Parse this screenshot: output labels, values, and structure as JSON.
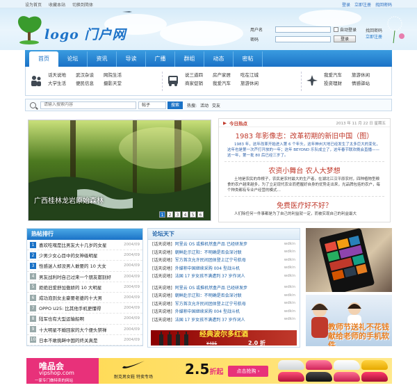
{
  "topbar": {
    "left_links": [
      "设为首页",
      "收藏本站",
      "切换到简体"
    ],
    "right_links": [
      "登录",
      "立即注册",
      "找回密码"
    ]
  },
  "header": {
    "logo_text": "logo 门户网"
  },
  "login": {
    "username_label": "用户名",
    "password_label": "密码",
    "remember_label": "自动登录",
    "login_button": "登录",
    "user_menu": [
      "找回密码",
      "立即注册"
    ]
  },
  "nav": {
    "items": [
      {
        "label": "首页",
        "active": true
      },
      {
        "label": "论坛",
        "active": false
      },
      {
        "label": "资讯",
        "active": false
      },
      {
        "label": "导读",
        "active": false
      },
      {
        "label": "广播",
        "active": false
      },
      {
        "label": "群组",
        "active": false
      },
      {
        "label": "动态",
        "active": false
      },
      {
        "label": "密帖",
        "active": false
      }
    ]
  },
  "subnav": {
    "groups": [
      {
        "icon": "people-icon",
        "links": [
          "话天说地",
          "武汉杂谈",
          "网院生活",
          "大学生活",
          "便民信息",
          "摄影天堂"
        ]
      },
      {
        "icon": "bus-icon",
        "links": [
          "说三道四",
          "房产家居",
          "吃在江城",
          "商家促销",
          "我爱汽车",
          "旅游休闲"
        ]
      },
      {
        "icon": "plane-icon",
        "links": [
          "我爱汽车",
          "旅游休闲",
          "投资理财",
          "情感驿站"
        ]
      }
    ]
  },
  "search": {
    "placeholder": "请输入搜索内容",
    "category": "帖子",
    "button": "搜索",
    "hot_label": "热搜:",
    "hot_words": [
      "活动",
      "交友"
    ]
  },
  "slideshow": {
    "caption": "广西桂林龙岩原始森林",
    "pages": [
      "1",
      "2",
      "3",
      "4",
      "5",
      "6"
    ],
    "active_page": "1"
  },
  "today_hot": {
    "title": "今日热点",
    "date": "2013 年 11 月 22 日 星期五",
    "headline1": "1983 年影像志：改革初期的新旧中国（图）",
    "desc1": "1983 年，这年改革开始进入第 6 个年头，这年神州大地已经发生了太多巨大的变化，这年也是第一次芦打开放的一年；这年 BEYOND 乐队成立了，这年春节联欢晚会直播——这一年，第一批 80 后已经三岁了。",
    "headline2": "农资小舞台 农人大梦想",
    "desc2": "土地是农民的命根子，农民是农村最大的生产者，在湖北江汉平原农村，四种植物型粮食的农户越来越多，为了立足现代农业而把握好自身的优势走出来，光品牌包括的农户，每个种类都有专业户经营的模式…",
    "headline3": "免费医疗好不好？",
    "desc3": "人们除任何一件事都是为了自己的利益就一定，而被实现自己的利益最大"
  },
  "forum_rank": {
    "title": "热帖排行",
    "items": [
      {
        "rank": "1",
        "title": "喜欢吃嘿是比男友大十几岁的女星",
        "date": "2004/09"
      },
      {
        "rank": "2",
        "title": "少男少女心目中的女神级明星",
        "date": "2004/09"
      },
      {
        "rank": "3",
        "title": "性感迷人却没男人敢要的 10 大女",
        "date": "2004/09"
      },
      {
        "rank": "4",
        "title": "男友战利时自己过来一个朋友都别好",
        "date": "2004/09"
      },
      {
        "rank": "5",
        "title": "拒绝旧爱舒加傲娇的 10 大明星",
        "date": "2004/09"
      },
      {
        "rank": "6",
        "title": "成功泡到女主豪要老婆的十大男",
        "date": "2004/09"
      },
      {
        "rank": "7",
        "title": "OPPO U25: 比其他手机更懂得",
        "date": "2004/09"
      },
      {
        "rank": "8",
        "title": "陆军也有大型运输船啊",
        "date": "2004/09"
      },
      {
        "rank": "9",
        "title": "十大明星不婚回家的大个便头禁禅",
        "date": "2004/09"
      },
      {
        "rank": "10",
        "title": "日本不敢挑衅中国的终关真是",
        "date": "2004/09"
      }
    ]
  },
  "forum_world": {
    "title": "论坛天下",
    "groups": [
      [
        {
          "cat": "[话天说地]",
          "title": "阿里云 OS 或推机然盒产品 已经研发步",
          "user": "wdkin"
        },
        {
          "cat": "[话天说地]",
          "title": "朝鲜赴示辽阳：不明确是否会深讨联",
          "user": "wdkin"
        },
        {
          "cat": "[话天说地]",
          "title": "军方首次允许民间团体登上辽宁号航母",
          "user": "wdkin"
        },
        {
          "cat": "[话天说地]",
          "title": "外媒称中国继续采购 004 型战斗机",
          "user": "wdkin"
        },
        {
          "cat": "[话天说地]",
          "title": "法国 17 岁女孩不满遭判 37 岁作词人",
          "user": "wdkin"
        }
      ],
      [
        {
          "cat": "[话天说地]",
          "title": "阿里云 OS 或推机然盒产品 已经研发步",
          "user": "wdkin"
        },
        {
          "cat": "[话天说地]",
          "title": "朝鲜赴示辽阳：不明确是否会深讨联",
          "user": "wdkin"
        },
        {
          "cat": "[话天说地]",
          "title": "军方首次允许民间团体登上辽宁号航母",
          "user": "wdkin"
        },
        {
          "cat": "[话天说地]",
          "title": "外媒称中国继续采购 004 型战斗机",
          "user": "wdkin"
        },
        {
          "cat": "[话天说地]",
          "title": "法国 17 岁女孩不满遭判 37 岁作词人",
          "user": "wdkin"
        }
      ]
    ],
    "wine_banner": {
      "text": "经典波尔多红酒",
      "old_price": "¥495",
      "new_price": "2.0 折"
    }
  },
  "ads": {
    "phone_label": "",
    "teacher_text": "教师节送礼不花钱 献给老师的手机软件"
  },
  "vip_banner": {
    "logo_cn": "唯品会",
    "logo_en": "vipshop.com",
    "slogan": "一家专门做特卖的网站",
    "nike_text": "耐克男女鞋 特卖专场",
    "discount": "2.5",
    "discount_unit": "折起",
    "button": "点击抢购"
  },
  "colors": {
    "brand": "#1b72c6",
    "hot": "#c0392b",
    "vip": "#e8317a",
    "banner_bg": "#ffd84d"
  }
}
